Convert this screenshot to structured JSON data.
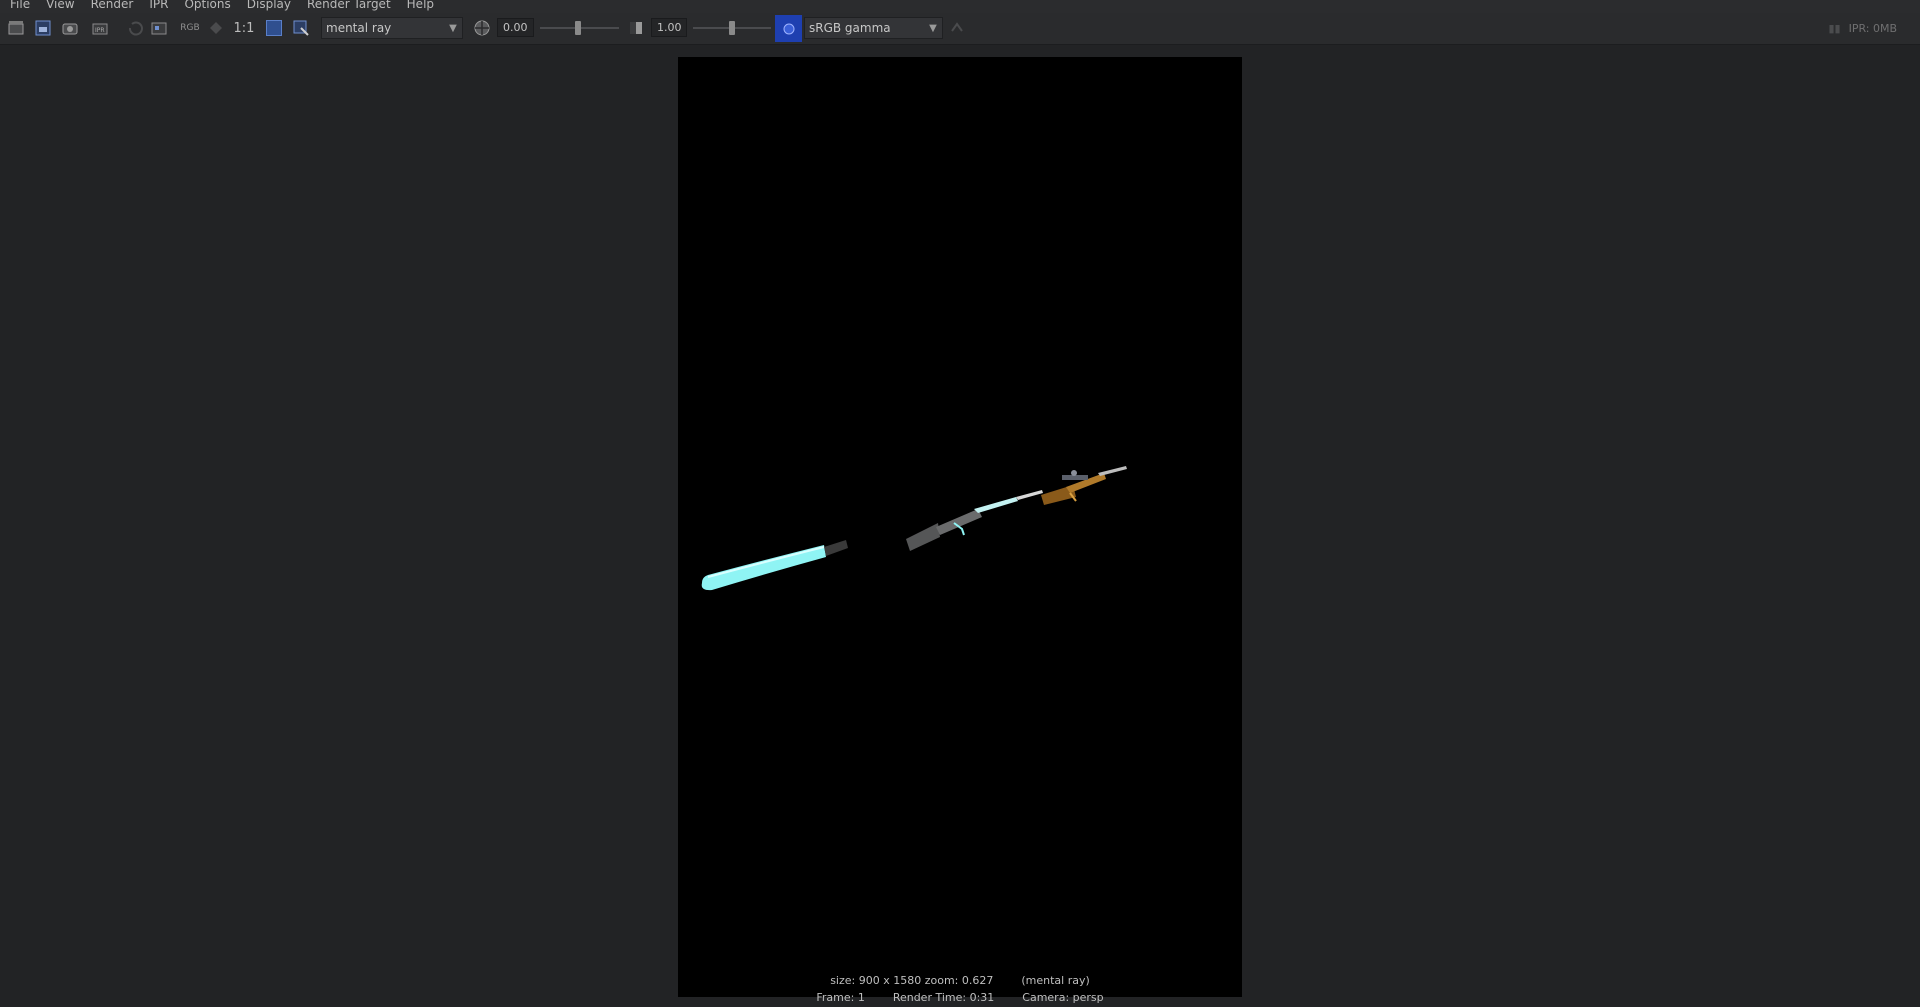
{
  "menubar": {
    "items": [
      {
        "label": "File"
      },
      {
        "label": "View"
      },
      {
        "label": "Render"
      },
      {
        "label": "IPR"
      },
      {
        "label": "Options"
      },
      {
        "label": "Display"
      },
      {
        "label": "Render Target"
      },
      {
        "label": "Help"
      }
    ]
  },
  "toolbar": {
    "rgb_label": "RGB",
    "one_to_one_label": "1:1",
    "renderer": "mental ray",
    "exposure_value": "0.00",
    "gamma_value": "1.00",
    "color_space": "sRGB gamma",
    "ipr_memory": "IPR: 0MB"
  },
  "render_info": {
    "size_zoom": "size: 900 x 1580 zoom: 0.627",
    "renderer_note": "(mental ray)",
    "frame": "Frame: 1",
    "render_time": "Render Time: 0:31",
    "camera": "Camera: persp"
  },
  "colors": {
    "background": "#222325",
    "toolbar": "#2a2b2d",
    "render_bg": "#000000",
    "glow_accent": "#8ff4f4",
    "color_mgmt_accent": "#2f4f8f"
  },
  "icons": [
    "clapboard-icon",
    "render-region-icon",
    "snapshot-icon",
    "ipr-render-icon",
    "refresh-icon",
    "keep-image-icon",
    "remove-image-icon",
    "rgb-channel-icon",
    "display-mode-icon",
    "real-size-icon",
    "frame-image-icon",
    "frame-region-icon",
    "exposure-icon",
    "gamma-icon",
    "color-management-icon",
    "sync-icon"
  ]
}
